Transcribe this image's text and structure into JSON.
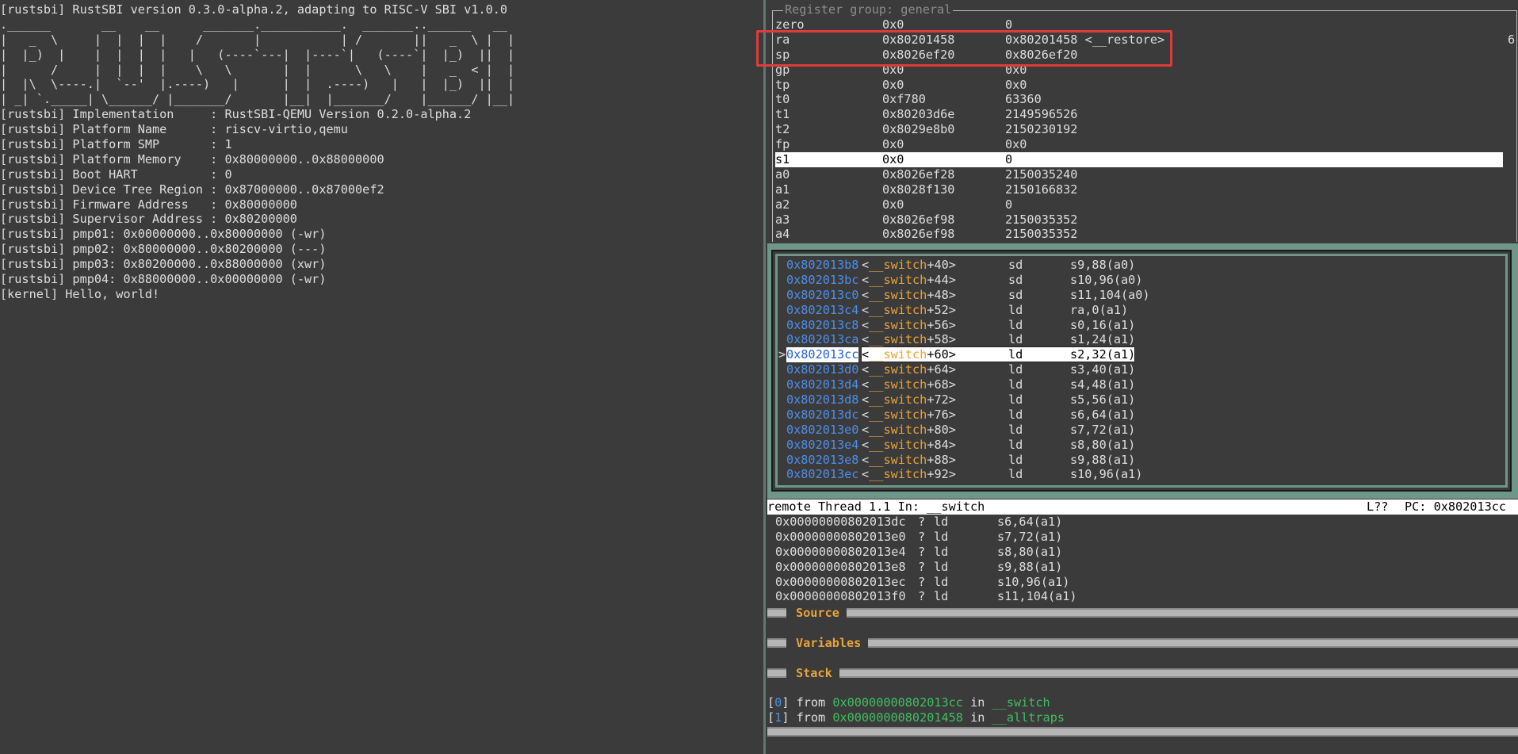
{
  "left_terminal": {
    "lines": [
      "[rustsbi] RustSBI version 0.3.0-alpha.2, adapting to RISC-V SBI v1.0.0",
      ".______       __    __      _______.___________.  _______..______   __",
      "|   _  \\     |  |  |  |    /       |           | /       ||   _  \\ |  |",
      "|  |_)  |    |  |  |  |   |   (----`---|  |----`|   (----`|  |_)  ||  |",
      "|      /     |  |  |  |    \\   \\       |  |      \\   \\    |   _  < |  |",
      "|  |\\  \\----.|  `--'  |.----)   |      |  |  .----)   |   |  |_)  ||  |",
      "| _| `._____| \\______/ |_______/       |__|  |_______/    |______/ |__|",
      "[rustsbi] Implementation     : RustSBI-QEMU Version 0.2.0-alpha.2",
      "[rustsbi] Platform Name      : riscv-virtio,qemu",
      "[rustsbi] Platform SMP       : 1",
      "[rustsbi] Platform Memory    : 0x80000000..0x88000000",
      "[rustsbi] Boot HART          : 0",
      "[rustsbi] Device Tree Region : 0x87000000..0x87000ef2",
      "[rustsbi] Firmware Address   : 0x80000000",
      "[rustsbi] Supervisor Address : 0x80200000",
      "[rustsbi] pmp01: 0x00000000..0x80000000 (-wr)",
      "[rustsbi] pmp02: 0x80000000..0x80200000 (---)",
      "[rustsbi] pmp03: 0x80200000..0x88000000 (xwr)",
      "[rustsbi] pmp04: 0x88000000..0x00000000 (-wr)",
      "[kernel] Hello, world!"
    ]
  },
  "registers": {
    "title": "Register group: general",
    "edge_number": "6",
    "rows": [
      {
        "name": "zero",
        "hex": "0x0",
        "value": "0"
      },
      {
        "name": "ra",
        "hex": "0x80201458",
        "value": "0x80201458 <__restore>"
      },
      {
        "name": "sp",
        "hex": "0x8026ef20",
        "value": "0x8026ef20"
      },
      {
        "name": "gp",
        "hex": "0x0",
        "value": "0x0"
      },
      {
        "name": "tp",
        "hex": "0x0",
        "value": "0x0"
      },
      {
        "name": "t0",
        "hex": "0xf780",
        "value": "63360"
      },
      {
        "name": "t1",
        "hex": "0x80203d6e",
        "value": "2149596526"
      },
      {
        "name": "t2",
        "hex": "0x8029e8b0",
        "value": "2150230192"
      },
      {
        "name": "fp",
        "hex": "0x0",
        "value": "0x0"
      },
      {
        "name": "s1",
        "hex": "0x0",
        "value": "0"
      },
      {
        "name": "a0",
        "hex": "0x8026ef28",
        "value": "2150035240"
      },
      {
        "name": "a1",
        "hex": "0x8028f130",
        "value": "2150166832"
      },
      {
        "name": "a2",
        "hex": "0x0",
        "value": "0"
      },
      {
        "name": "a3",
        "hex": "0x8026ef98",
        "value": "2150035352"
      },
      {
        "name": "a4",
        "hex": "0x8026ef98",
        "value": "2150035352"
      }
    ]
  },
  "asm": {
    "current_marker": ">",
    "rows": [
      {
        "addr": "0x802013b8",
        "fn": "__switch",
        "off": "+40>",
        "op": "sd",
        "args": "s9,88(a0)"
      },
      {
        "addr": "0x802013bc",
        "fn": "__switch",
        "off": "+44>",
        "op": "sd",
        "args": "s10,96(a0)"
      },
      {
        "addr": "0x802013c0",
        "fn": "__switch",
        "off": "+48>",
        "op": "sd",
        "args": "s11,104(a0)"
      },
      {
        "addr": "0x802013c4",
        "fn": "__switch",
        "off": "+52>",
        "op": "ld",
        "args": "ra,0(a1)"
      },
      {
        "addr": "0x802013c8",
        "fn": "__switch",
        "off": "+56>",
        "op": "ld",
        "args": "s0,16(a1)"
      },
      {
        "addr": "0x802013ca",
        "fn": "__switch",
        "off": "+58>",
        "op": "ld",
        "args": "s1,24(a1)"
      },
      {
        "addr": "0x802013cc",
        "fn": "__switch",
        "off": "+60>",
        "op": "ld",
        "args": "s2,32(a1)"
      },
      {
        "addr": "0x802013d0",
        "fn": "__switch",
        "off": "+64>",
        "op": "ld",
        "args": "s3,40(a1)"
      },
      {
        "addr": "0x802013d4",
        "fn": "__switch",
        "off": "+68>",
        "op": "ld",
        "args": "s4,48(a1)"
      },
      {
        "addr": "0x802013d8",
        "fn": "__switch",
        "off": "+72>",
        "op": "ld",
        "args": "s5,56(a1)"
      },
      {
        "addr": "0x802013dc",
        "fn": "__switch",
        "off": "+76>",
        "op": "ld",
        "args": "s6,64(a1)"
      },
      {
        "addr": "0x802013e0",
        "fn": "__switch",
        "off": "+80>",
        "op": "ld",
        "args": "s7,72(a1)"
      },
      {
        "addr": "0x802013e4",
        "fn": "__switch",
        "off": "+84>",
        "op": "ld",
        "args": "s8,80(a1)"
      },
      {
        "addr": "0x802013e8",
        "fn": "__switch",
        "off": "+88>",
        "op": "ld",
        "args": "s9,88(a1)"
      },
      {
        "addr": "0x802013ec",
        "fn": "__switch",
        "off": "+92>",
        "op": "ld",
        "args": "s10,96(a1)"
      }
    ]
  },
  "status": {
    "left": "remote Thread 1.1 In: __switch",
    "line": "L??",
    "pc": "PC: 0x802013cc"
  },
  "bottom_asm": {
    "rows": [
      {
        "addr": "0x00000000802013dc",
        "q": "?",
        "op": "ld",
        "args": "s6,64(a1)"
      },
      {
        "addr": "0x00000000802013e0",
        "q": "?",
        "op": "ld",
        "args": "s7,72(a1)"
      },
      {
        "addr": "0x00000000802013e4",
        "q": "?",
        "op": "ld",
        "args": "s8,80(a1)"
      },
      {
        "addr": "0x00000000802013e8",
        "q": "?",
        "op": "ld",
        "args": "s9,88(a1)"
      },
      {
        "addr": "0x00000000802013ec",
        "q": "?",
        "op": "ld",
        "args": "s10,96(a1)"
      },
      {
        "addr": "0x00000000802013f0",
        "q": "?",
        "op": "ld",
        "args": "s11,104(a1)"
      }
    ]
  },
  "sections": {
    "source": "Source",
    "variables": "Variables",
    "stack": "Stack"
  },
  "stack": {
    "frames": [
      {
        "idx": "0",
        "from": "from",
        "addr": "0x00000000802013cc",
        "in": "in",
        "fn": "__switch"
      },
      {
        "idx": "1",
        "from": "from",
        "addr": "0x0000000080201458",
        "in": "in",
        "fn": "__alltraps"
      }
    ]
  },
  "colors": {
    "background": "#3b3b3b",
    "pane_accent": "#6e978a",
    "address_blue": "#4d8ee8",
    "symbol_orange": "#e8a33a",
    "stack_green": "#3fbf5f",
    "highlight_red": "#e03b3b"
  }
}
